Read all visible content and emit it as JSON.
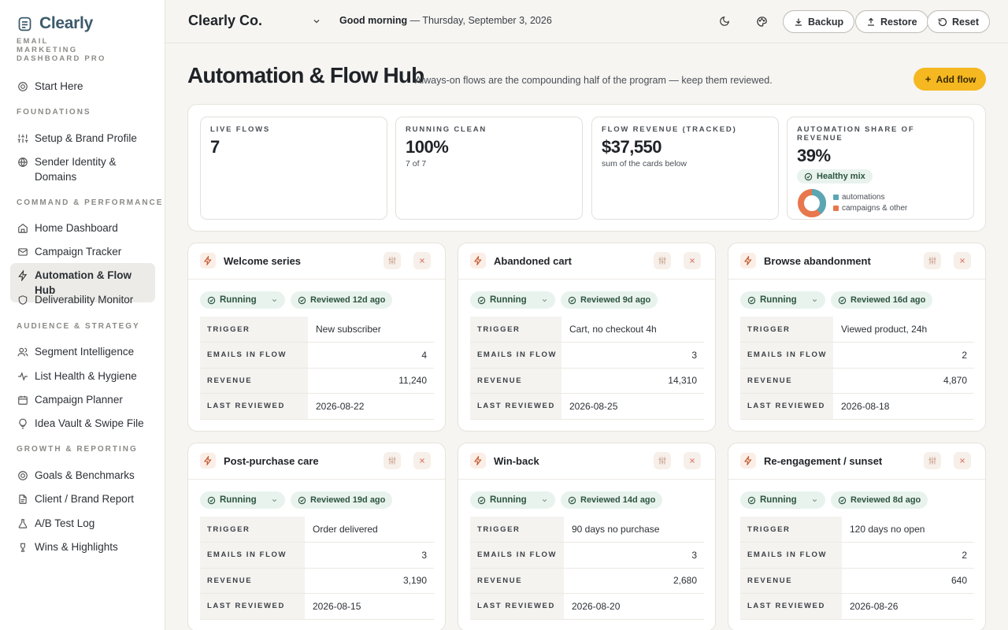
{
  "brand": {
    "name": "Clearly",
    "subtitle": "EMAIL MARKETING DASHBOARD PRO"
  },
  "sidebar": {
    "start": "Start Here",
    "sections": [
      {
        "title": "FOUNDATIONS",
        "items": [
          "Setup & Brand Profile",
          "Sender Identity & Domains"
        ]
      },
      {
        "title": "COMMAND & PERFORMANCE",
        "items": [
          "Home Dashboard",
          "Campaign Tracker",
          "Automation & Flow Hub",
          "Deliverability Monitor"
        ]
      },
      {
        "title": "AUDIENCE & STRATEGY",
        "items": [
          "Segment Intelligence",
          "List Health & Hygiene",
          "Campaign Planner",
          "Idea Vault & Swipe File"
        ]
      },
      {
        "title": "GROWTH & REPORTING",
        "items": [
          "Goals & Benchmarks",
          "Client / Brand Report",
          "A/B Test Log",
          "Wins & Highlights"
        ]
      }
    ],
    "active": "Automation & Flow Hub"
  },
  "topbar": {
    "company": "Clearly Co.",
    "greeting_bold": "Good morning",
    "greeting_rest": " — Thursday, September 3, 2026",
    "backup": "Backup",
    "restore": "Restore",
    "reset": "Reset"
  },
  "header": {
    "title": "Automation & Flow Hub",
    "subtitle": "Always-on flows are the compounding half of the program — keep them reviewed.",
    "add_flow": "Add flow"
  },
  "stats": {
    "live": {
      "label": "LIVE FLOWS",
      "value": "7"
    },
    "clean": {
      "label": "RUNNING CLEAN",
      "value": "100%",
      "note": "7 of 7"
    },
    "revenue": {
      "label": "FLOW REVENUE (TRACKED)",
      "value": "$37,550",
      "note": "sum of the cards below"
    },
    "share": {
      "label": "AUTOMATION SHARE OF REVENUE",
      "value": "39%",
      "badge": "Healthy mix",
      "share_fraction": 0.39,
      "legend": [
        "automations",
        "campaigns & other"
      ],
      "colors": {
        "automations": "#5aa6b3",
        "other": "#e8774d"
      }
    }
  },
  "labels": {
    "trigger": "TRIGGER",
    "emails": "EMAILS IN FLOW",
    "revenue": "REVENUE",
    "last": "LAST REVIEWED",
    "status": "Running"
  },
  "flows": [
    {
      "name": "Welcome series",
      "reviewed": "Reviewed 12d ago",
      "trigger": "New subscriber",
      "emails": "4",
      "revenue": "11,240",
      "last": "2026-08-22"
    },
    {
      "name": "Abandoned cart",
      "reviewed": "Reviewed 9d ago",
      "trigger": "Cart, no checkout 4h",
      "emails": "3",
      "revenue": "14,310",
      "last": "2026-08-25"
    },
    {
      "name": "Browse abandonment",
      "reviewed": "Reviewed 16d ago",
      "trigger": "Viewed product, 24h",
      "emails": "2",
      "revenue": "4,870",
      "last": "2026-08-18"
    },
    {
      "name": "Post-purchase care",
      "reviewed": "Reviewed 19d ago",
      "trigger": "Order delivered",
      "emails": "3",
      "revenue": "3,190",
      "last": "2026-08-15"
    },
    {
      "name": "Win-back",
      "reviewed": "Reviewed 14d ago",
      "trigger": "90 days no purchase",
      "emails": "3",
      "revenue": "2,680",
      "last": "2026-08-20"
    },
    {
      "name": "Re-engagement / sunset",
      "reviewed": "Reviewed 8d ago",
      "trigger": "120 days no open",
      "emails": "2",
      "revenue": "640",
      "last": "2026-08-26"
    }
  ]
}
